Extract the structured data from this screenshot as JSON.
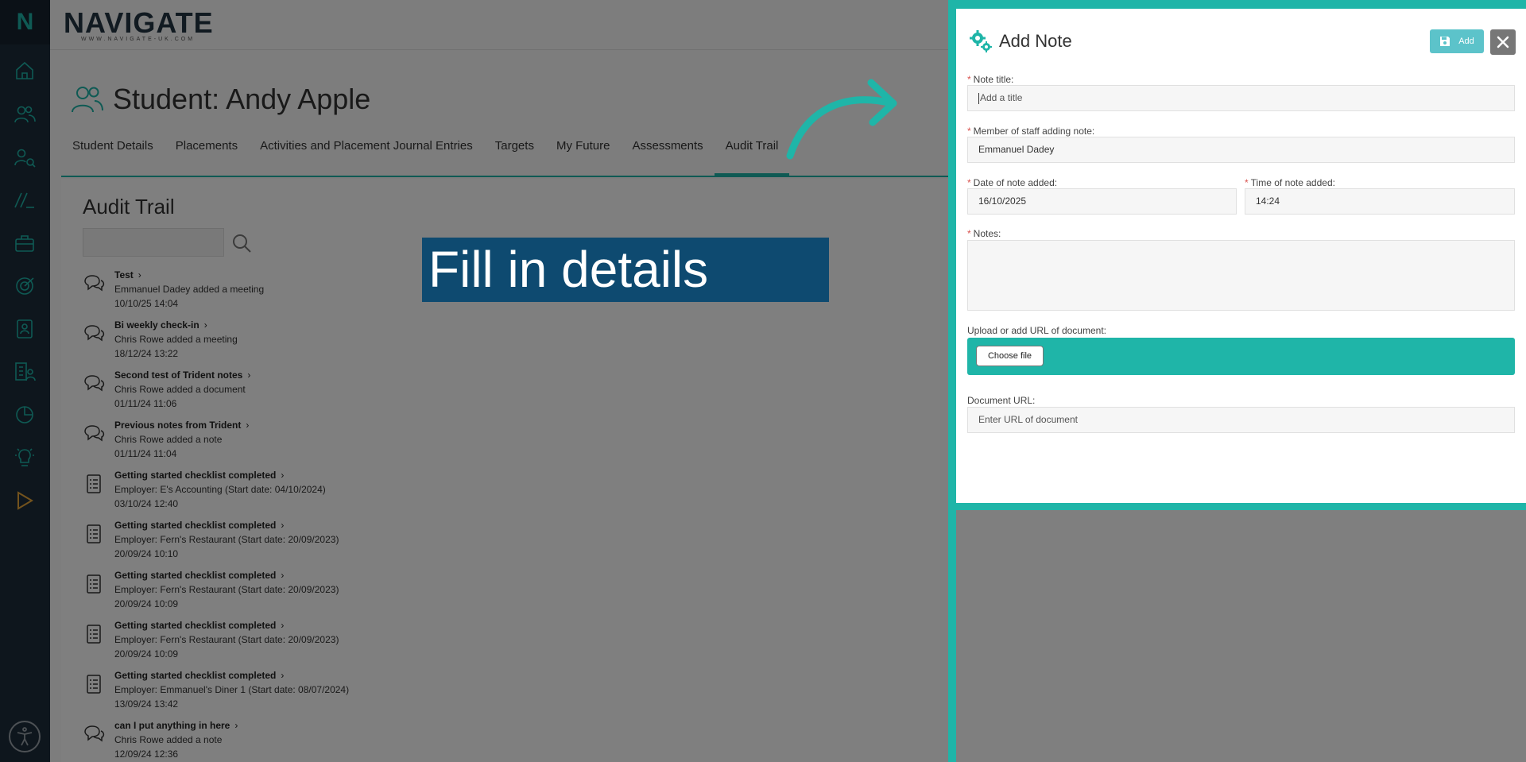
{
  "app": {
    "logo_letter": "N",
    "brand_name": "NAVIGATE",
    "brand_url": "WWW.NAVIGATE-UK.COM"
  },
  "sidebar": {
    "items": [
      {
        "icon": "home-icon"
      },
      {
        "icon": "users-icon"
      },
      {
        "icon": "user-search-icon"
      },
      {
        "icon": "slashes-icon"
      },
      {
        "icon": "briefcase-icon"
      },
      {
        "icon": "target-icon"
      },
      {
        "icon": "contact-book-icon"
      },
      {
        "icon": "building-user-icon"
      },
      {
        "icon": "pie-chart-icon"
      },
      {
        "icon": "lightbulb-icon"
      },
      {
        "icon": "play-icon"
      }
    ],
    "accessibility_icon": "accessibility-icon"
  },
  "student": {
    "title": "Student: Andy Apple"
  },
  "tabs": [
    {
      "label": "Student Details"
    },
    {
      "label": "Placements"
    },
    {
      "label": "Activities and Placement Journal Entries"
    },
    {
      "label": "Targets"
    },
    {
      "label": "My Future"
    },
    {
      "label": "Assessments"
    },
    {
      "label": "Audit Trail"
    }
  ],
  "audit": {
    "heading": "Audit Trail",
    "search_placeholder": "",
    "items": [
      {
        "icon": "chat-icon",
        "title": "Test",
        "subtitle": "Emmanuel Dadey added a meeting",
        "date": "10/10/25 14:04"
      },
      {
        "icon": "chat-icon",
        "title": "Bi weekly check-in",
        "subtitle": "Chris Rowe added a meeting",
        "date": "18/12/24 13:22"
      },
      {
        "icon": "chat-icon",
        "title": "Second test of Trident notes",
        "subtitle": "Chris Rowe added a document",
        "date": "01/11/24 11:06"
      },
      {
        "icon": "chat-icon",
        "title": "Previous notes from Trident",
        "subtitle": "Chris Rowe added a note",
        "date": "01/11/24 11:04"
      },
      {
        "icon": "checklist-icon",
        "title": "Getting started checklist completed",
        "subtitle": "Employer: E's Accounting (Start date: 04/10/2024)",
        "date": "03/10/24 12:40"
      },
      {
        "icon": "checklist-icon",
        "title": "Getting started checklist completed",
        "subtitle": "Employer: Fern's Restaurant (Start date: 20/09/2023)",
        "date": "20/09/24 10:10"
      },
      {
        "icon": "checklist-icon",
        "title": "Getting started checklist completed",
        "subtitle": "Employer: Fern's Restaurant (Start date: 20/09/2023)",
        "date": "20/09/24 10:09"
      },
      {
        "icon": "checklist-icon",
        "title": "Getting started checklist completed",
        "subtitle": "Employer: Fern's Restaurant (Start date: 20/09/2023)",
        "date": "20/09/24 10:09"
      },
      {
        "icon": "checklist-icon",
        "title": "Getting started checklist completed",
        "subtitle": "Employer: Emmanuel's Diner 1 (Start date: 08/07/2024)",
        "date": "13/09/24 13:42"
      },
      {
        "icon": "chat-icon",
        "title": "can I put anything in here",
        "subtitle": "Chris Rowe added a note",
        "date": "12/09/24 12:36"
      }
    ]
  },
  "callout": {
    "text": "Fill in details"
  },
  "modal": {
    "title": "Add Note",
    "add_label": "Add",
    "fields": {
      "note_title_label": "Note title:",
      "note_title_placeholder": "Add a title",
      "staff_label": "Member of staff adding note:",
      "staff_value": "Emmanuel Dadey",
      "date_label": "Date of note added:",
      "date_value": "16/10/2025",
      "time_label": "Time of note added:",
      "time_value": "14:24",
      "notes_label": "Notes:",
      "upload_label": "Upload or add URL of document:",
      "choose_file_label": "Choose file",
      "doc_url_label": "Document URL:",
      "doc_url_placeholder": "Enter URL of document"
    },
    "required_marker": "*"
  },
  "colors": {
    "brand_teal": "#1fb5a8",
    "sidebar_dark": "#1d2d3a",
    "callout_blue": "#0e4a70",
    "add_button": "#5cc3ca",
    "close_button": "#777777"
  }
}
